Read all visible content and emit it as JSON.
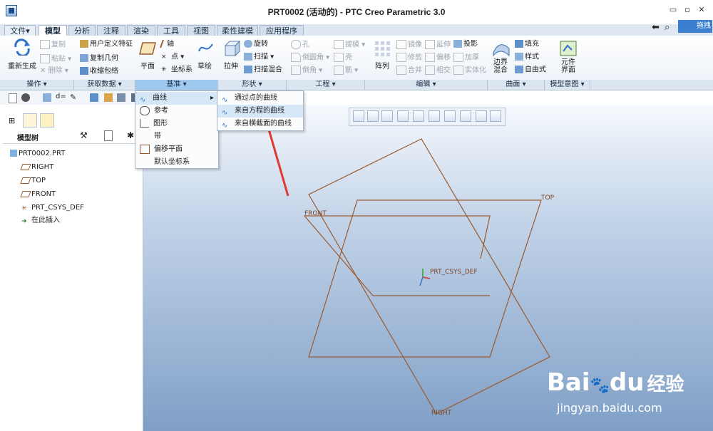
{
  "window": {
    "title": "PRT0002 (活动的) - PTC Creo Parametric 3.0",
    "controls": [
      "▭",
      "▫",
      "✕"
    ]
  },
  "tabs": [
    "文件▾",
    "模型",
    "分析",
    "注释",
    "渲染",
    "工具",
    "视图",
    "柔性建模",
    "应用程序"
  ],
  "right_tools": {
    "pin_label": "拖拽"
  },
  "ribbon": {
    "regen": "重新生成",
    "copy": "复制",
    "paste": "粘贴 ▾",
    "delete": "✕ 删除 ▾",
    "udf": "用户定义特征",
    "copy_geom": "复制几何",
    "shrinkwrap": "收缩包络",
    "plane": "平面",
    "axis": "轴",
    "point": "点 ▾",
    "csys": "坐标系",
    "sketch": "草绘",
    "extrude": "拉伸",
    "revolve": "旋转",
    "sweep": "扫描 ▾",
    "swept_blend": "扫描混合",
    "hole": "孔",
    "round": "倒圆角 ▾",
    "chamfer": "倒角 ▾",
    "draft": "拔模 ▾",
    "shell": "壳",
    "rib": "筋 ▾",
    "pattern": "阵列",
    "mirror": "镜像",
    "trim": "修剪",
    "merge": "合并",
    "extend": "延伸",
    "offset": "偏移",
    "intersect": "相交",
    "project": "投影",
    "thicken": "加厚",
    "solidify": "实体化",
    "boundary_blend": "边界\n混合",
    "fill": "填充",
    "style": "样式",
    "freestyle": "自由式",
    "component_interface": "元件\n界面"
  },
  "groups": [
    "操作 ▾",
    "获取数据 ▾",
    "基准 ▾",
    "形状 ▾",
    "工程 ▾",
    "编辑 ▾",
    "曲面 ▾",
    "模型意图 ▾"
  ],
  "model_tree": {
    "header": "模型树",
    "items": [
      "PRT0002.PRT",
      "RIGHT",
      "TOP",
      "FRONT",
      "PRT_CSYS_DEF",
      "在此插入"
    ]
  },
  "datum_menu": {
    "items": [
      "曲线",
      "参考",
      "图形",
      "带",
      "偏移平面",
      "默认坐标系"
    ],
    "submenu_arrow": "▸"
  },
  "curve_submenu": {
    "items": [
      "通过点的曲线",
      "来自方程的曲线",
      "来自横截面的曲线"
    ]
  },
  "viewport_labels": {
    "top": "TOP",
    "front": "FRONT",
    "right": "RIGHT",
    "csys": "PRT_CSYS_DEF"
  },
  "watermark": {
    "brand": "Bai",
    "brand2": "du",
    "cn": "经验",
    "url": "jingyan.baidu.com"
  },
  "colors": {
    "accent": "#9fc8ef",
    "datum_plane": "#9a5a2e",
    "arrow": "#e03a30"
  }
}
